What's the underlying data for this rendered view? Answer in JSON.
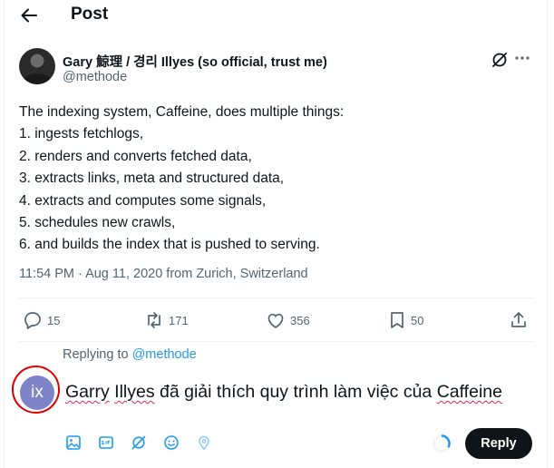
{
  "header": {
    "title": "Post"
  },
  "author": {
    "name": "Gary 鯨理 / 경리 Illyes (so official, trust me)",
    "handle": "@methode"
  },
  "tweet": {
    "lines": [
      "The indexing system, Caffeine, does multiple things:",
      "1. ingests fetchlogs,",
      "2. renders and converts fetched data,",
      "3. extracts links, meta and structured data,",
      "4. extracts and computes some signals,",
      "5. schedules new crawls,",
      "6. and builds the index that is pushed to serving."
    ],
    "meta": "11:54 PM · Aug 11, 2020 from Zurich, Switzerland"
  },
  "actions": {
    "replies": "15",
    "reposts": "171",
    "likes": "356",
    "bookmarks": "50"
  },
  "reply": {
    "replying_prefix": "Replying to ",
    "replying_handle": "@methode",
    "avatar_initials": "ix",
    "draft_part1": "Garry",
    "draft_part2": " ",
    "draft_part3": "Illyes",
    "draft_part4": " đã giải thích quy trình làm việc của ",
    "draft_part5": "Caffeine",
    "button_label": "Reply"
  },
  "icons": {
    "back": "arrow-left-icon",
    "grok": "grok-icon",
    "more": "more-icon",
    "reply": "reply-icon",
    "repost": "repost-icon",
    "like": "heart-icon",
    "bookmark": "bookmark-icon",
    "share": "share-icon",
    "media": "image-icon",
    "gif": "gif-icon",
    "grok_compose": "grok-icon",
    "emoji": "emoji-icon",
    "location": "location-icon"
  },
  "colors": {
    "accent": "#1d9bf0",
    "text": "#0f1419",
    "muted": "#536471",
    "annotation": "#e00000",
    "avatar": "#7f83c8"
  }
}
